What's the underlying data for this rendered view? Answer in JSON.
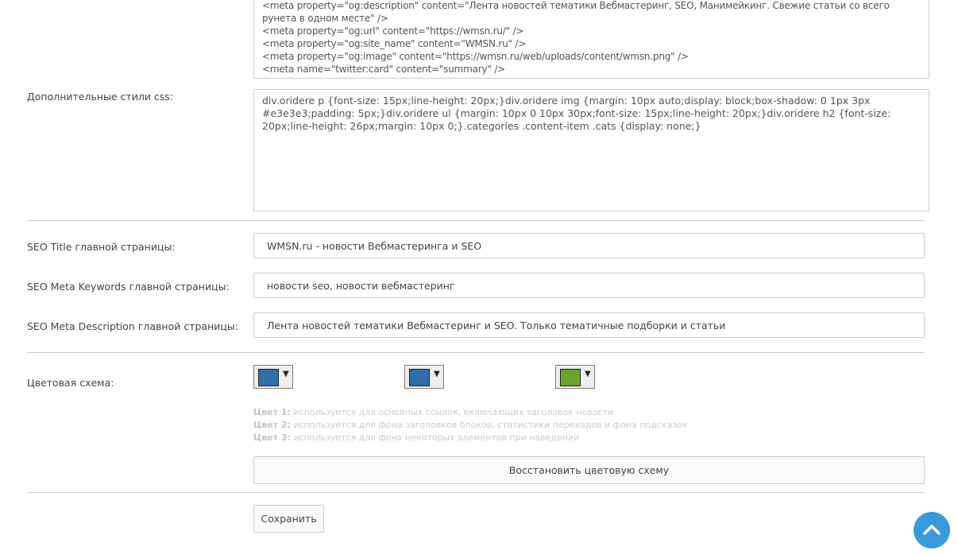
{
  "meta_textarea": {
    "lines": [
      "<meta property=\"og:description\" content=\"Лента новостей тематики Вебмастеринг, SEO, Манимейкинг. Свежие статьи со всего рунета в одном месте\" />",
      "<meta property=\"og:url\" content=\"https://wmsn.ru/\" />",
      "<meta property=\"og:site_name\" content=\"WMSN.ru\" />",
      "<meta property=\"og:image\" content=\"https://wmsn.ru/web/uploads/content/wmsn.png\" />",
      "<meta name=\"twitter:card\" content=\"summary\" />"
    ]
  },
  "css": {
    "label": "Дополнительные стили css:",
    "value": "div.oridere p {font-size: 15px;line-height: 20px;}div.oridere img {margin: 10px auto;display: block;box-shadow: 0 1px 3px #e3e3e3;padding: 5px;}div.oridere ul {margin: 10px 0 10px 30px;font-size: 15px;line-height: 20px;}div.oridere h2 {font-size: 20px;line-height: 26px;margin: 10px 0;}.categories .content-item .cats {display: none;}"
  },
  "seo": {
    "title_label": "SEO Title главной страницы:",
    "title_value": "WMSN.ru - новости Вебмастеринга и SEO",
    "keywords_label": "SEO Meta Keywords главной страницы:",
    "keywords_value": "новости seo, новости вебмастеринг",
    "description_label": "SEO Meta Description главной страницы:",
    "description_value": "Лента новостей тематики Вебмастеринг и SEO. Только тематичные подборки и статьи"
  },
  "colors": {
    "label": "Цветовая схема:",
    "swatches": [
      "#2f6ea9",
      "#2f6ea9",
      "#6aa42f"
    ],
    "help": [
      {
        "key": "Цвет 1:",
        "text": " используется для основных ссылок, включающих заголовок новости"
      },
      {
        "key": "Цвет 2:",
        "text": " используется для фона заголовков блоков, статистики переходов и фона подсказок"
      },
      {
        "key": "Цвет 3:",
        "text": " используется для фона некоторых элементов при наведении"
      }
    ],
    "restore_label": "Восстановить цветовую схему"
  },
  "save_label": "Сохранить",
  "scroll_top_color": "#3a9ad9"
}
